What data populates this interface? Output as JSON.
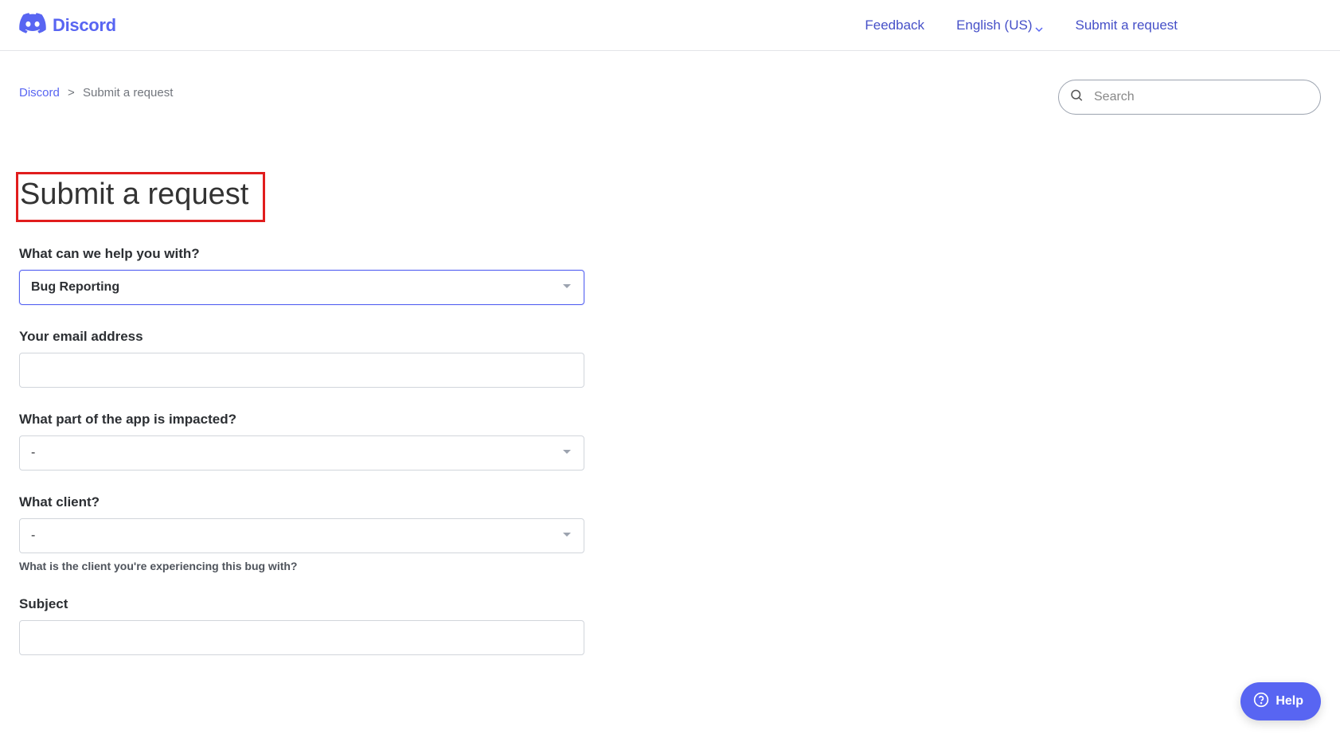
{
  "header": {
    "brand": "Discord",
    "nav": {
      "feedback": "Feedback",
      "language": "English (US)",
      "submit": "Submit a request"
    }
  },
  "breadcrumb": {
    "root": "Discord",
    "current": "Submit a request"
  },
  "search": {
    "placeholder": "Search"
  },
  "page": {
    "title": "Submit a request"
  },
  "form": {
    "help_with": {
      "label": "What can we help you with?",
      "value": "Bug Reporting"
    },
    "email": {
      "label": "Your email address",
      "value": ""
    },
    "app_part": {
      "label": "What part of the app is impacted?",
      "value": "-"
    },
    "client": {
      "label": "What client?",
      "value": "-",
      "helper": "What is the client you're experiencing this bug with?"
    },
    "subject": {
      "label": "Subject",
      "value": ""
    }
  },
  "help_widget": {
    "label": "Help"
  }
}
